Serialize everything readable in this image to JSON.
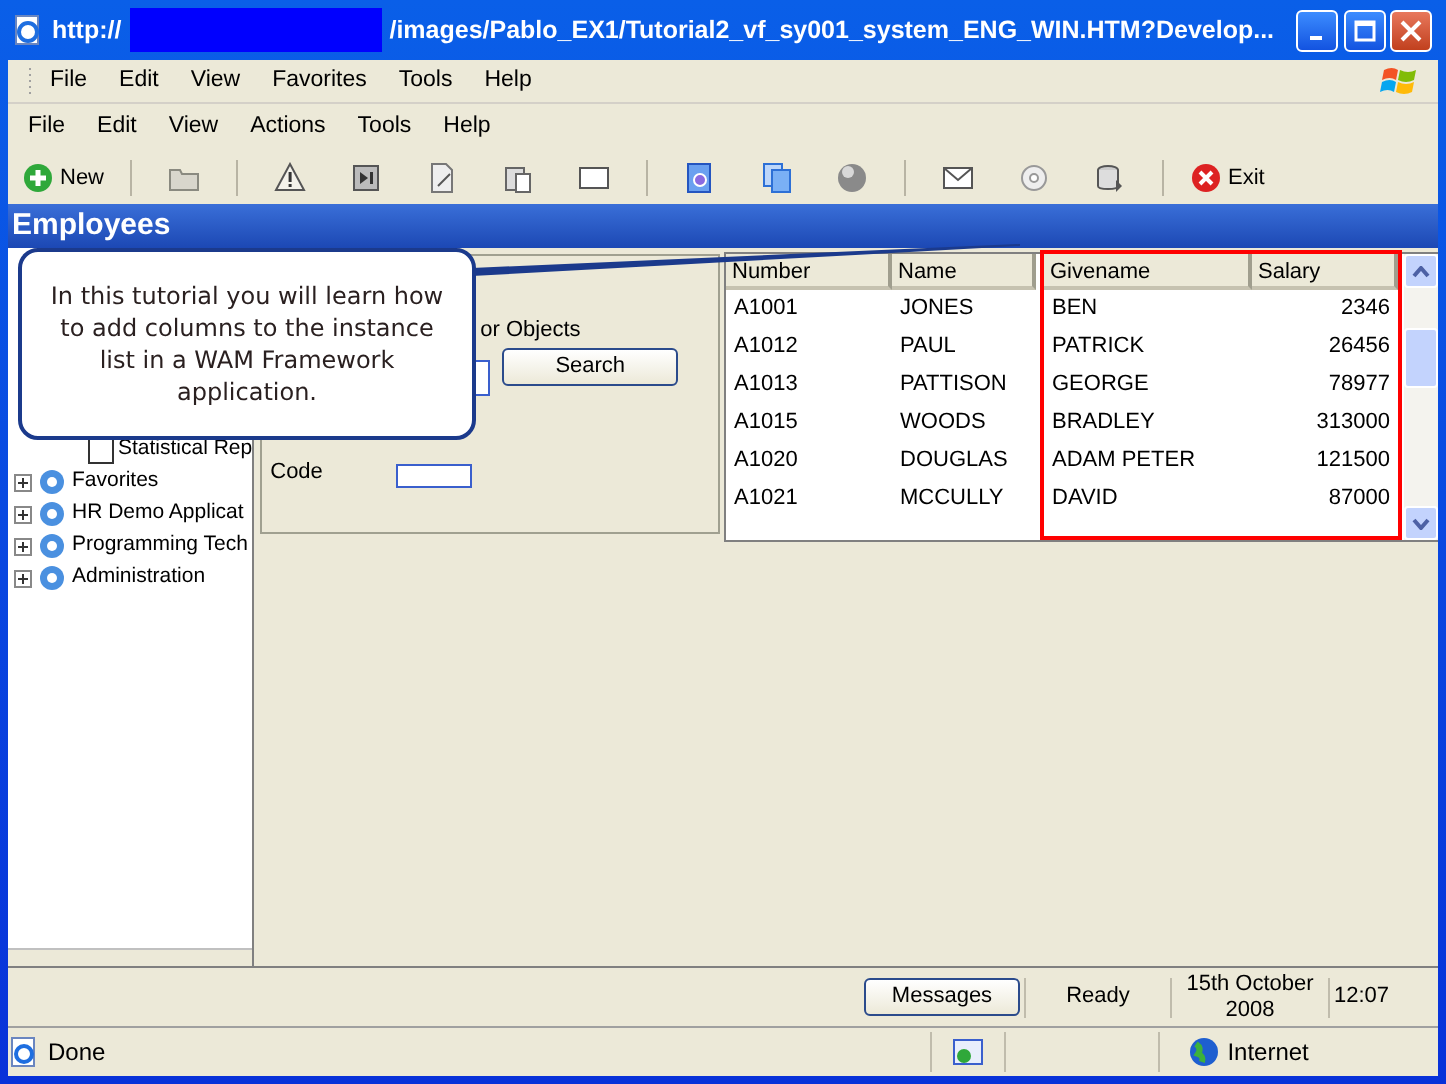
{
  "window": {
    "title_prefix": "http://",
    "title_suffix": "/images/Pablo_EX1/Tutorial2_vf_sy001_system_ENG_WIN.HTM?Develop..."
  },
  "browser_menu": [
    "File",
    "Edit",
    "View",
    "Favorites",
    "Tools",
    "Help"
  ],
  "app_menu": [
    "File",
    "Edit",
    "View",
    "Actions",
    "Tools",
    "Help"
  ],
  "toolbar": [
    {
      "kind": "text-button",
      "label": "New"
    },
    {
      "kind": "separator"
    },
    {
      "kind": "icon-button"
    },
    {
      "kind": "separator"
    },
    {
      "kind": "icon-button"
    },
    {
      "kind": "icon-button"
    },
    {
      "kind": "icon-button"
    },
    {
      "kind": "icon-button"
    },
    {
      "kind": "icon-button"
    },
    {
      "kind": "separator"
    },
    {
      "kind": "icon-button"
    },
    {
      "kind": "icon-button"
    },
    {
      "kind": "icon-button"
    },
    {
      "kind": "separator"
    },
    {
      "kind": "icon-button"
    },
    {
      "kind": "icon-button"
    },
    {
      "kind": "icon-button"
    },
    {
      "kind": "separator"
    },
    {
      "kind": "text-button",
      "label": "Exit"
    }
  ],
  "header": "Employees",
  "callout": "In this tutorial you will learn how to add columns to the instance list in a WAM Framework application.",
  "search_panel": {
    "heading": "or Objects",
    "search_button": "Search",
    "field_label": "Code"
  },
  "tree": [
    {
      "kind": "leaf",
      "label": "Statistical Rep"
    },
    {
      "kind": "folder",
      "label": "Favorites",
      "expanded": false
    },
    {
      "kind": "folder",
      "label": "HR Demo Applicat",
      "expanded": false
    },
    {
      "kind": "folder",
      "label": "Programming Tech",
      "expanded": false
    },
    {
      "kind": "folder",
      "label": "Administration",
      "expanded": false
    }
  ],
  "table": {
    "columns": [
      {
        "label": "Number",
        "kind": "text",
        "highlighted": false
      },
      {
        "label": "Name",
        "kind": "text",
        "highlighted": false
      },
      {
        "label": "Givename",
        "kind": "text",
        "highlighted": true
      },
      {
        "label": "Salary",
        "kind": "number",
        "highlighted": true
      }
    ],
    "rows": [
      [
        "A1001",
        "JONES",
        "BEN",
        "2346"
      ],
      [
        "A1012",
        "PAUL",
        "PATRICK",
        "26456"
      ],
      [
        "A1013",
        "PATTISON",
        "GEORGE",
        "78977"
      ],
      [
        "A1015",
        "WOODS",
        "BRADLEY",
        "313000"
      ],
      [
        "A1020",
        "DOUGLAS",
        "ADAM PETER",
        "121500"
      ],
      [
        "A1021",
        "MCCULLY",
        "DAVID",
        "87000"
      ]
    ]
  },
  "status_bar": {
    "messages_button": "Messages",
    "state": "Ready",
    "date": "15th October 2008",
    "time": "12:07"
  },
  "browser_status": {
    "text": "Done",
    "zone": "Internet"
  }
}
